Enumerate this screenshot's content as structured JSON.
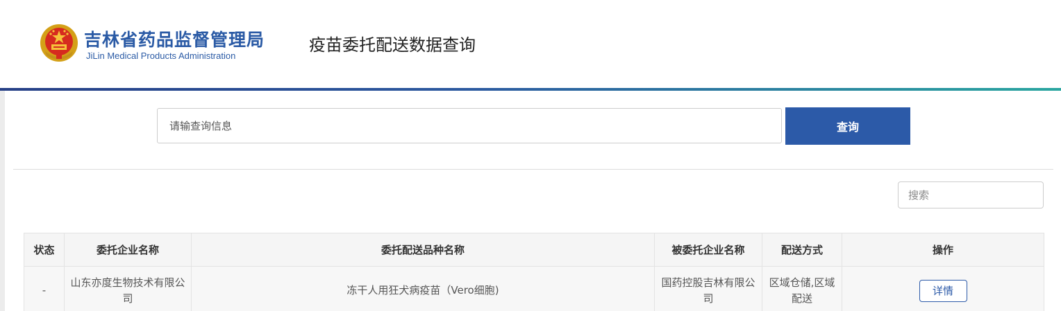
{
  "header": {
    "org_name_cn": "吉林省药品监督管理局",
    "org_name_en": "JiLin Medical Products Administration",
    "page_title": "疫苗委托配送数据查询"
  },
  "search": {
    "placeholder": "请输查询信息",
    "button_label": "查询"
  },
  "table_search": {
    "placeholder": "搜索"
  },
  "table": {
    "columns": [
      "状态",
      "委托企业名称",
      "委托配送品种名称",
      "被委托企业名称",
      "配送方式",
      "操作"
    ],
    "rows": [
      {
        "status": "-",
        "entrusting_company": "山东亦度生物技术有限公司",
        "product_name": "冻干人用狂犬病疫苗（Vero细胞)",
        "entrusted_company": "国药控股吉林有限公司",
        "delivery_method": "区域仓储,区域配送",
        "action_label": "详情"
      }
    ]
  },
  "colors": {
    "brand_blue": "#2c5aa8",
    "header_bar_start": "#263f86",
    "header_bar_end": "#2aa6a0"
  }
}
